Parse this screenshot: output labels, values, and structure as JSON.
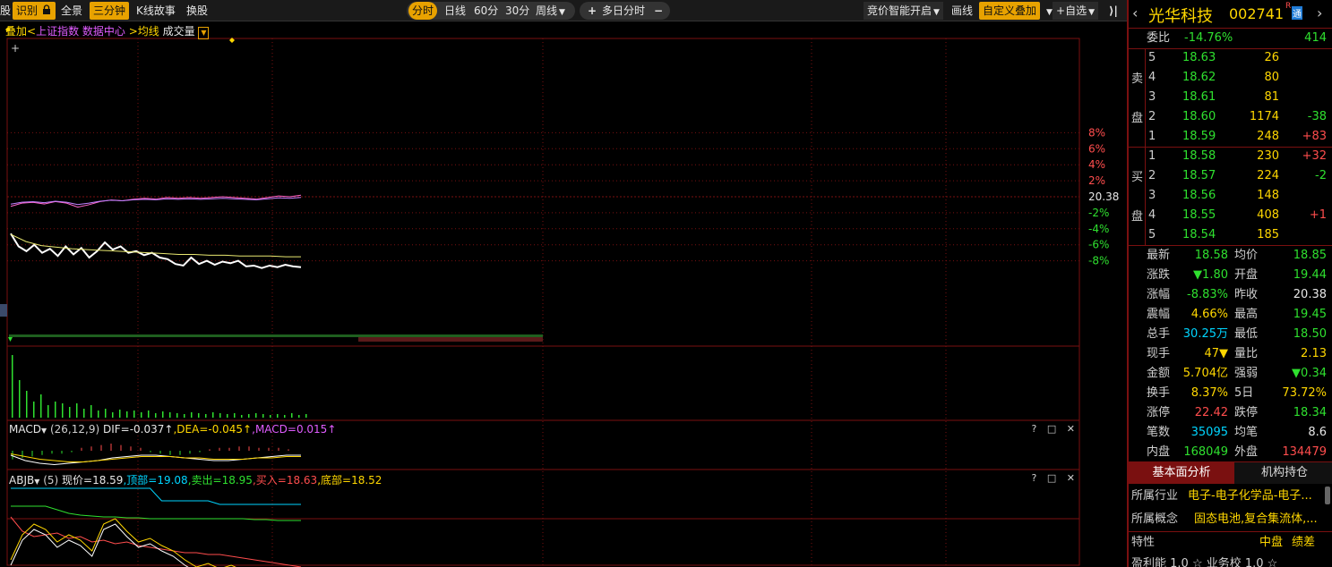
{
  "toolbar": {
    "left": [
      {
        "label": "股",
        "active": false
      },
      {
        "label": "识别",
        "active": true
      },
      {
        "label": "全景",
        "active": false
      },
      {
        "label": "三分钟",
        "active": true
      },
      {
        "label": "K线故事",
        "active": false
      },
      {
        "label": "换股",
        "active": false
      }
    ],
    "period_tabs": [
      {
        "label": "分时",
        "active": true
      },
      {
        "label": "日线",
        "active": false
      },
      {
        "label": "60分",
        "active": false
      },
      {
        "label": "30分",
        "active": false
      },
      {
        "label": "周线",
        "active": false
      }
    ],
    "multiday_label": "多日分时",
    "right": [
      {
        "label": "竞价智能开启",
        "active": false
      },
      {
        "label": "画线",
        "active": false
      },
      {
        "label": "自定义叠加",
        "active": true
      },
      {
        "label": "自选",
        "active": false
      }
    ]
  },
  "overlay_bar": {
    "prefix": "叠加<",
    "index": "上证指数",
    "data_center": "数据中心",
    "avg_line": ">均线",
    "volume": "成交量"
  },
  "price_axis": {
    "right_labels": [
      "8%",
      "6%",
      "4%",
      "2%",
      "20.38",
      "-2%",
      "-4%",
      "-6%",
      "-8%"
    ],
    "prev_close": 20.38,
    "pct_levels": [
      8,
      6,
      4,
      2,
      0,
      -2,
      -4,
      -6,
      -8
    ]
  },
  "macd": {
    "name": "MACD",
    "params": "(26,12,9)",
    "dif": "DIF=-0.037↑",
    "dea": "DEA=-0.045↑",
    "macd": "MACD=0.015↑"
  },
  "abjb": {
    "name": "ABJB",
    "params": "(5)",
    "now": "现价=18.59",
    "top": "顶部=19.08",
    "sell": "卖出=18.95",
    "buy": "买入=18.63",
    "bottom": "底部=18.52"
  },
  "quote": {
    "name": "光华科技",
    "code": "002741",
    "badge_r": "R",
    "badge_t": "通",
    "weibi_label": "委比",
    "weibi_value": "-14.76%",
    "weicha_value": "414",
    "sell_side_label": [
      "卖",
      "盘"
    ],
    "buy_side_label": [
      "买",
      "盘"
    ],
    "asks": [
      {
        "level": "5",
        "price": "18.63",
        "vol": "26",
        "chg": ""
      },
      {
        "level": "4",
        "price": "18.62",
        "vol": "80",
        "chg": ""
      },
      {
        "level": "3",
        "price": "18.61",
        "vol": "81",
        "chg": ""
      },
      {
        "level": "2",
        "price": "18.60",
        "vol": "1174",
        "chg": "-38"
      },
      {
        "level": "1",
        "price": "18.59",
        "vol": "248",
        "chg": "+83"
      }
    ],
    "bids": [
      {
        "level": "1",
        "price": "18.58",
        "vol": "230",
        "chg": "+32"
      },
      {
        "level": "2",
        "price": "18.57",
        "vol": "224",
        "chg": "-2"
      },
      {
        "level": "3",
        "price": "18.56",
        "vol": "148",
        "chg": ""
      },
      {
        "level": "4",
        "price": "18.55",
        "vol": "408",
        "chg": "+1"
      },
      {
        "level": "5",
        "price": "18.54",
        "vol": "185",
        "chg": ""
      }
    ],
    "stats": [
      {
        "l1": "最新",
        "v1": "18.58",
        "c1": "green",
        "l2": "均价",
        "v2": "18.85",
        "c2": "green"
      },
      {
        "l1": "涨跌",
        "v1": "▼1.80",
        "c1": "green",
        "l2": "开盘",
        "v2": "19.44",
        "c2": "green"
      },
      {
        "l1": "涨幅",
        "v1": "-8.83%",
        "c1": "green",
        "l2": "昨收",
        "v2": "20.38",
        "c2": "white"
      },
      {
        "l1": "震幅",
        "v1": "4.66%",
        "c1": "yellow",
        "l2": "最高",
        "v2": "19.45",
        "c2": "green"
      },
      {
        "l1": "总手",
        "v1": "30.25万",
        "c1": "cyan",
        "l2": "最低",
        "v2": "18.50",
        "c2": "green"
      },
      {
        "l1": "现手",
        "v1": "47▼",
        "c1": "yellow",
        "l2": "量比",
        "v2": "2.13",
        "c2": "yellow"
      },
      {
        "l1": "金额",
        "v1": "5.704亿",
        "c1": "yellow",
        "l2": "强弱",
        "v2": "▼0.34",
        "c2": "green"
      },
      {
        "l1": "换手",
        "v1": "8.37%",
        "c1": "yellow",
        "l2": "5日",
        "v2": "73.72%",
        "c2": "yellow"
      },
      {
        "l1": "涨停",
        "v1": "22.42",
        "c1": "red",
        "l2": "跌停",
        "v2": "18.34",
        "c2": "green"
      },
      {
        "l1": "笔数",
        "v1": "35095",
        "c1": "cyan",
        "l2": "均笔",
        "v2": "8.6",
        "c2": "white"
      },
      {
        "l1": "内盘",
        "v1": "168049",
        "c1": "green",
        "l2": "外盘",
        "v2": "134479",
        "c2": "red"
      }
    ],
    "tabs": [
      "基本面分析",
      "机构持仓"
    ],
    "industry_label": "所属行业",
    "industry_value": "电子-电子化学品-电子...",
    "concept_label": "所属概念",
    "concept_value": "固态电池,复合集流体,...",
    "feature_label": "特性",
    "feature_values": [
      "中盘",
      "绩差"
    ],
    "bottom_partial": "盈利能    1.0 ☆  业务校    1.0 ☆"
  },
  "colors": {
    "accent": "#e8a200",
    "grid_red": "#7a1010",
    "price_line": "#ffffff",
    "avg_line": "#e8e870",
    "index_line": "#ff66cc",
    "volume_bar": "#2fe02f"
  }
}
